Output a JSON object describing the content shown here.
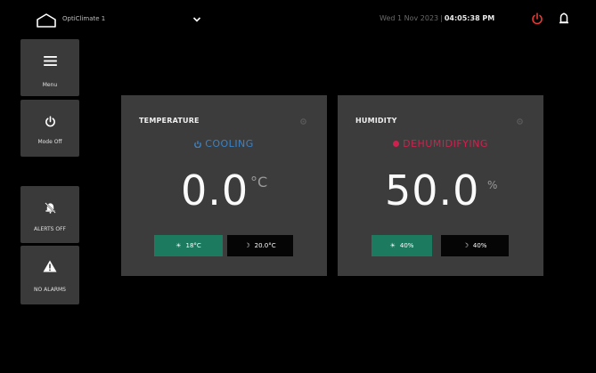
{
  "header": {
    "device_name": "OptiClimate 1",
    "date": "Wed 1 Nov 2023",
    "separator": "|",
    "time": "04:05:38 PM"
  },
  "sidebar": {
    "menu_label": "Menu",
    "mode_label": "Mode Off",
    "alerts_label": "ALERTS OFF",
    "alarms_label": "NO ALARMS"
  },
  "temperature": {
    "title": "TEMPERATURE",
    "status": "COOLING",
    "value": "0.0",
    "unit": "°C",
    "day_setpoint": "18°C",
    "night_setpoint": "20.0°C"
  },
  "humidity": {
    "title": "HUMIDITY",
    "status": "DEHUMIDIFYING",
    "value": "50.0",
    "unit": "%",
    "day_setpoint": "40%",
    "night_setpoint": "40%"
  },
  "colors": {
    "background": "#000000",
    "panel": "#3c3c3c",
    "sidebar_button": "#3a3a3a",
    "accent_green": "#1c7a5f",
    "cooling_blue": "#3b82c4",
    "dehumidify_pink": "#d0214e",
    "power_red": "#e53935"
  },
  "icons": {
    "home": "house-icon",
    "dropdown": "chevron-down-icon",
    "power": "power-icon",
    "bell": "bell-icon",
    "menu": "hamburger-icon",
    "alerts": "bell-muted-icon",
    "alarm": "warning-triangle-icon",
    "day": "sun-icon",
    "night": "moon-icon",
    "settings": "gear-icon"
  }
}
